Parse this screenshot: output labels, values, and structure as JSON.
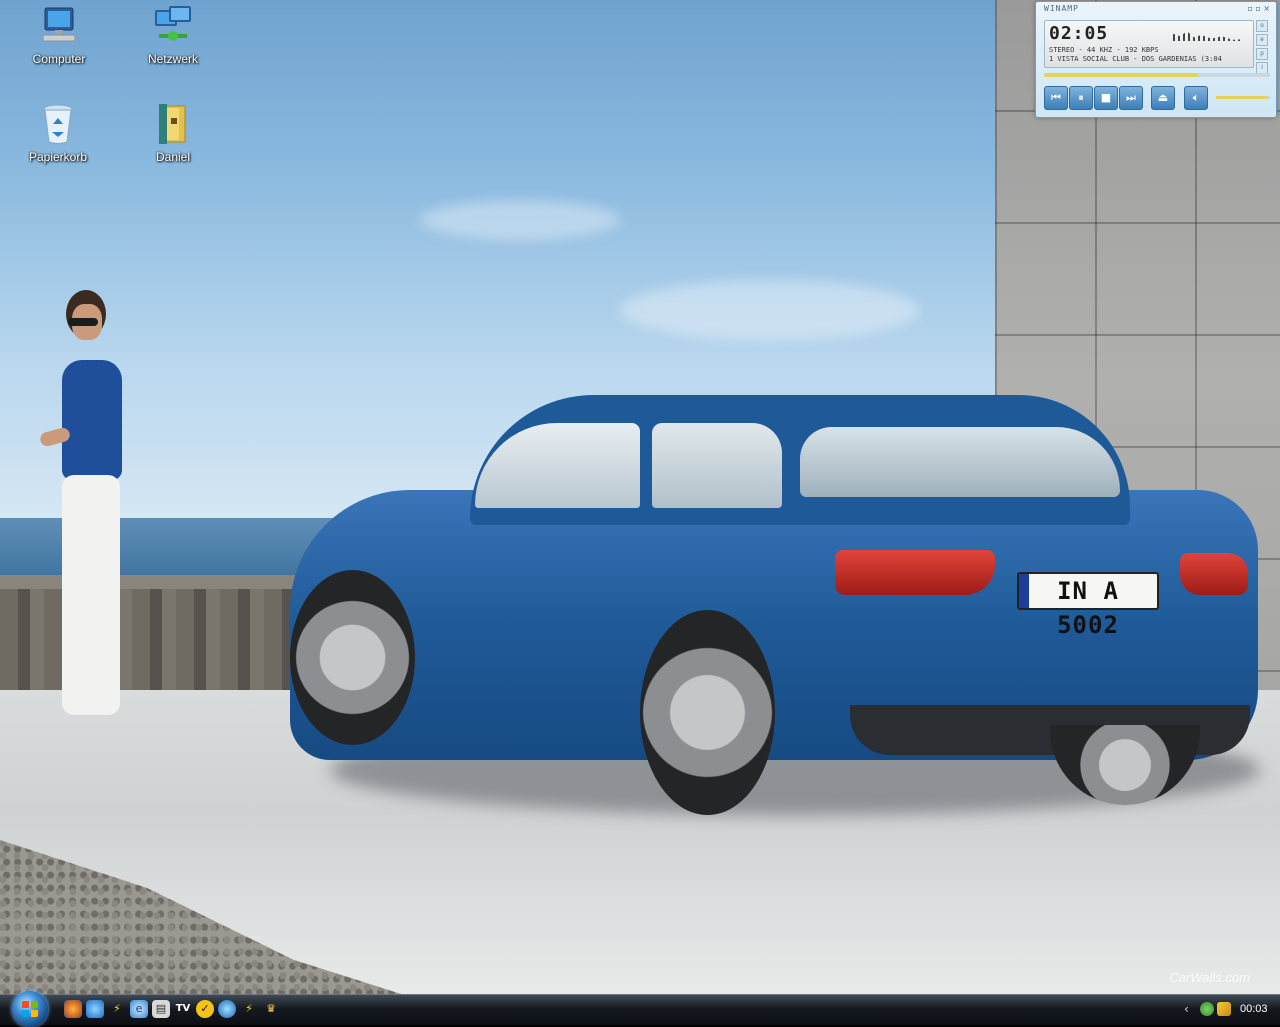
{
  "desktop": {
    "icons": [
      {
        "label": "Computer",
        "icon": "computer-icon"
      },
      {
        "label": "Netzwerk",
        "icon": "network-icon"
      },
      {
        "label": "Papierkorb",
        "icon": "recycle-bin-icon"
      },
      {
        "label": "Daniel",
        "icon": "user-folder-icon"
      }
    ],
    "watermark": "CarWalls.com",
    "license_plate": "IN A 5002"
  },
  "winamp": {
    "title": "WINAMP",
    "time": "02:05",
    "stream_info": "STEREO - 44 KHZ - 192 KBPS",
    "track": "1 VISTA SOCIAL CLUB - DOS GARDENIAS (3:04",
    "seek_progress": 0.68,
    "volume": 0.95,
    "buttons": [
      "previous",
      "pause",
      "stop",
      "next",
      "eject",
      "volume"
    ]
  },
  "taskbar": {
    "quick_launch": [
      "firefox-icon",
      "internet-icon",
      "winamp-icon",
      "ie-icon",
      "explorer-icon",
      "tv-icon",
      "norton-icon",
      "network-icon",
      "winamp-icon",
      "trophy-icon"
    ],
    "tray": {
      "chevron": "‹",
      "clock": "00:03"
    }
  },
  "colors": {
    "taskbar": "#151a20",
    "winamp_accent": "#3d7eb6",
    "car_blue": "#1f5a98"
  }
}
